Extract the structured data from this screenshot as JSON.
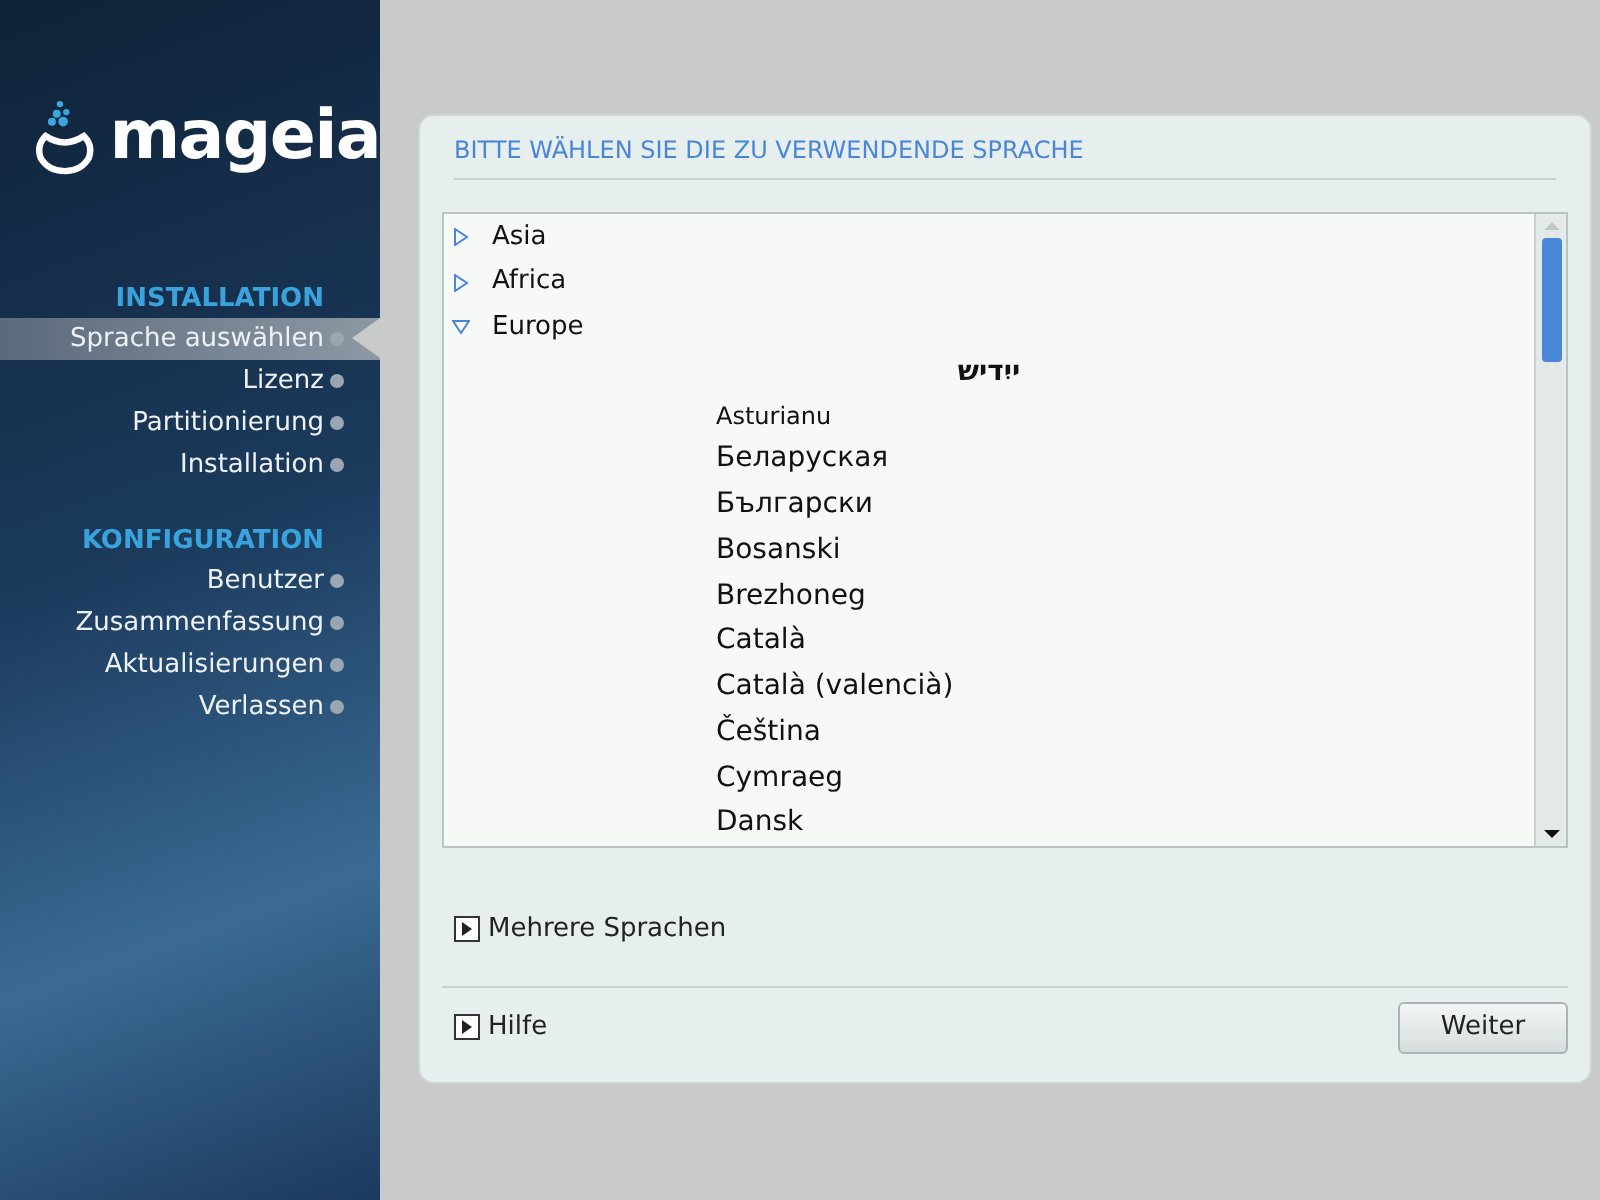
{
  "logo": {
    "text": "mageia"
  },
  "sidebar": {
    "sections": [
      {
        "title": "INSTALLATION",
        "items": [
          {
            "label": "Sprache auswählen",
            "selected": true
          },
          {
            "label": "Lizenz",
            "selected": false
          },
          {
            "label": "Partitionierung",
            "selected": false
          },
          {
            "label": "Installation",
            "selected": false
          }
        ]
      },
      {
        "title": "KONFIGURATION",
        "items": [
          {
            "label": "Benutzer",
            "selected": false
          },
          {
            "label": "Zusammenfassung",
            "selected": false
          },
          {
            "label": "Aktualisierungen",
            "selected": false
          },
          {
            "label": "Verlassen",
            "selected": false
          }
        ]
      }
    ]
  },
  "dialog": {
    "title": "BITTE WÄHLEN SIE DIE ZU VERWENDENDE SPRACHE",
    "tree": [
      {
        "label": "Asia",
        "expanded": false
      },
      {
        "label": "Africa",
        "expanded": false
      },
      {
        "label": "Europe",
        "expanded": true,
        "children": [
          {
            "label": "ייִדיש",
            "kind": "rtl"
          },
          {
            "label": "Asturianu",
            "kind": "small"
          },
          {
            "label": "Беларуская",
            "kind": "normal"
          },
          {
            "label": "Български",
            "kind": "normal"
          },
          {
            "label": "Bosanski",
            "kind": "normal"
          },
          {
            "label": "Brezhoneg",
            "kind": "normal"
          },
          {
            "label": "Català",
            "kind": "normal"
          },
          {
            "label": "Català (valencià)",
            "kind": "normal"
          },
          {
            "label": "Čeština",
            "kind": "normal"
          },
          {
            "label": "Cymraeg",
            "kind": "normal"
          },
          {
            "label": "Dansk",
            "kind": "normal"
          }
        ]
      }
    ],
    "expanders": [
      {
        "label": "Mehrere Sprachen",
        "expanded": false
      }
    ],
    "help": {
      "label": "Hilfe",
      "expanded": false
    },
    "button": "Weiter"
  }
}
